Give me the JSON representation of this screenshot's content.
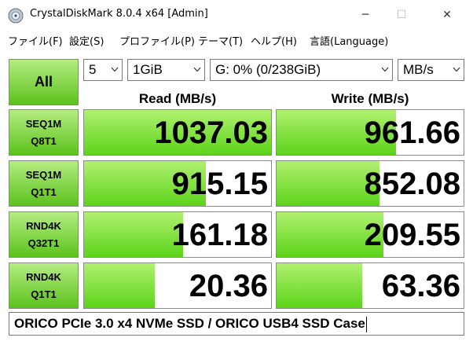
{
  "window": {
    "title": "CrystalDiskMark 8.0.4 x64 [Admin]",
    "icon": "crystaldiskmark-disk-icon",
    "controls": {
      "minimize": "─",
      "maximize": "☐",
      "close": "✕"
    }
  },
  "menu": [
    "ファイル(F)",
    "設定(S)",
    "プロファイル(P)",
    "テーマ(T)",
    "ヘルプ(H)",
    "言語(Language)"
  ],
  "toolbar": {
    "all_label": "All",
    "count": "5",
    "size": "1GiB",
    "drive": "G: 0% (0/238GiB)",
    "unit": "MB/s"
  },
  "headers": {
    "read": "Read (MB/s)",
    "write": "Write (MB/s)"
  },
  "rows": [
    {
      "line1": "SEQ1M",
      "line2": "Q8T1",
      "read": "1037.03",
      "write": "961.66",
      "read_fill": 1.0,
      "write_fill": 0.64
    },
    {
      "line1": "SEQ1M",
      "line2": "Q1T1",
      "read": "915.15",
      "write": "852.08",
      "read_fill": 0.65,
      "write_fill": 0.55
    },
    {
      "line1": "RND4K",
      "line2": "Q32T1",
      "read": "161.18",
      "write": "209.55",
      "read_fill": 0.53,
      "write_fill": 0.57
    },
    {
      "line1": "RND4K",
      "line2": "Q1T1",
      "read": "20.36",
      "write": "63.36",
      "read_fill": 0.38,
      "write_fill": 0.46
    }
  ],
  "comment": "ORICO PCIe 3.0 x4 NVMe SSD / ORICO USB4 SSD Case",
  "colors": {
    "accent_green": "#5cc21c",
    "bar_green": "#5cd41a",
    "border": "#8a8a8a"
  }
}
